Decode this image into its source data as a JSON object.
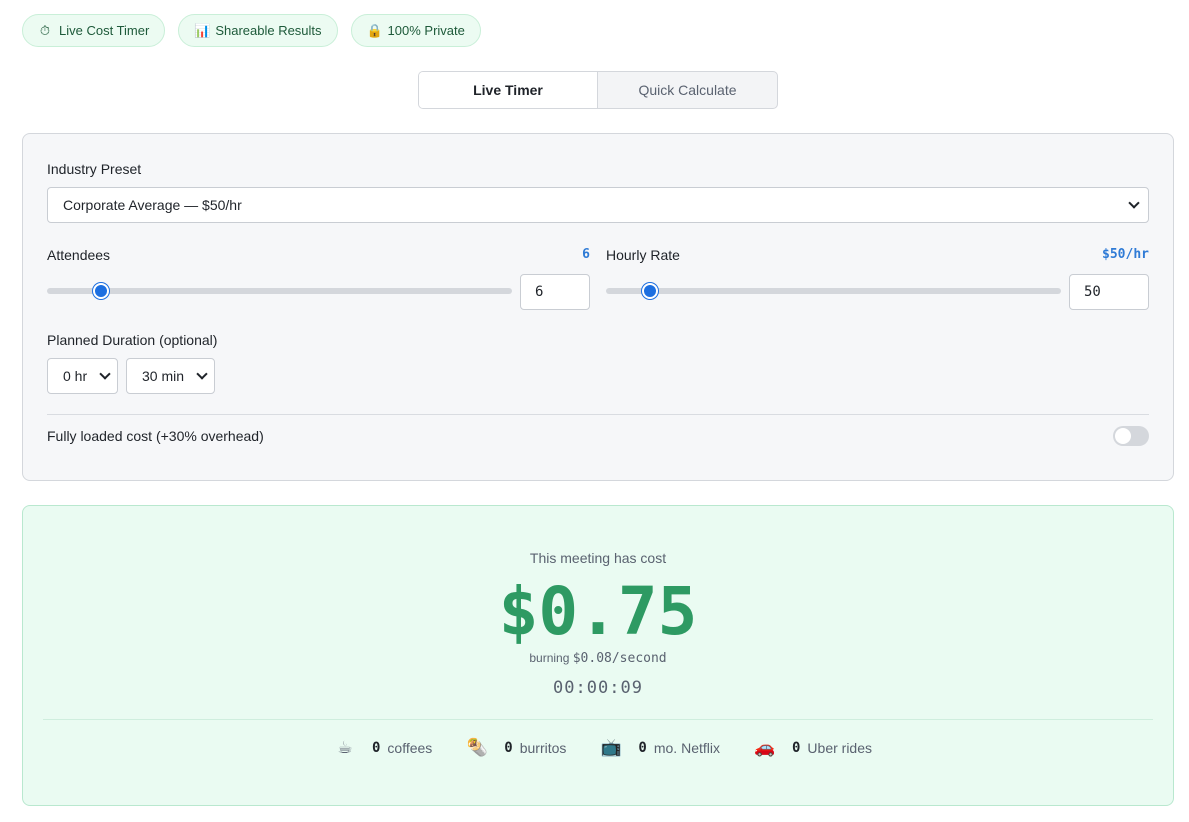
{
  "badges": [
    {
      "icon": "stopwatch-icon",
      "glyph": "⏱",
      "label": "Live Cost Timer"
    },
    {
      "icon": "bar-chart-icon",
      "glyph": "📊",
      "label": "Shareable Results"
    },
    {
      "icon": "lock-icon",
      "glyph": "🔒",
      "label": "100% Private"
    }
  ],
  "tabs": [
    {
      "label": "Live Timer",
      "active": true
    },
    {
      "label": "Quick Calculate",
      "active": false
    }
  ],
  "form": {
    "preset_label": "Industry Preset",
    "preset_value": "Corporate Average — $50/hr",
    "attendees_label": "Attendees",
    "attendees_display": "6",
    "attendees_value": "6",
    "attendees_min": 1,
    "attendees_max": 50,
    "rate_label": "Hourly Rate",
    "rate_display": "$50/hr",
    "rate_value": "50",
    "rate_min": 10,
    "rate_max": 500,
    "duration_label": "Planned Duration (optional)",
    "duration_hours": "0 hr",
    "duration_minutes": "30 min",
    "overhead_label": "Fully loaded cost (+30% overhead)",
    "overhead_enabled": false
  },
  "result": {
    "intro": "This meeting has cost",
    "cost": "$0.75",
    "burn_prefix": "burning",
    "burn_rate": "$0.08/second",
    "elapsed": "00:00:09",
    "equivalents": [
      {
        "icon": "coffee-icon",
        "glyph": "☕",
        "count": "0",
        "label": "coffees"
      },
      {
        "icon": "burrito-icon",
        "glyph": "🌯",
        "count": "0",
        "label": "burritos"
      },
      {
        "icon": "tv-icon",
        "glyph": "📺",
        "count": "0",
        "label": "mo. Netflix"
      },
      {
        "icon": "car-icon",
        "glyph": "🚗",
        "count": "0",
        "label": "Uber rides"
      }
    ]
  },
  "colors": {
    "accent_blue": "#1d6fe0",
    "cost_green": "#2e9a63",
    "result_bg": "#eafbf2"
  }
}
